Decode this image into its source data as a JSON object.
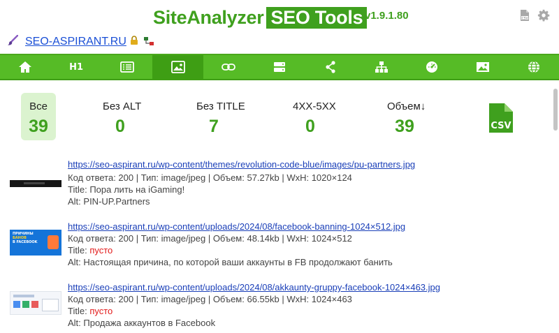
{
  "app": {
    "title_part1": "SiteAnalyzer",
    "title_part2": "SEO Tools",
    "version": "v1.9.1.80"
  },
  "site": {
    "domain": "SEO-ASPIRANT.RU"
  },
  "nav": {
    "tabs": [
      {
        "name": "home",
        "icon": "home-icon"
      },
      {
        "name": "h1",
        "label": "H1"
      },
      {
        "name": "list",
        "icon": "list-icon"
      },
      {
        "name": "images",
        "icon": "image-icon",
        "active": true
      },
      {
        "name": "links",
        "icon": "link-icon"
      },
      {
        "name": "server",
        "icon": "server-icon"
      },
      {
        "name": "share",
        "icon": "share-icon"
      },
      {
        "name": "sitemap",
        "icon": "sitemap-icon"
      },
      {
        "name": "speed",
        "icon": "gauge-icon"
      },
      {
        "name": "pictures",
        "icon": "picture-icon"
      },
      {
        "name": "globe",
        "icon": "globe-icon"
      }
    ]
  },
  "stats": [
    {
      "label": "Все",
      "value": "39"
    },
    {
      "label": "Без ALT",
      "value": "0"
    },
    {
      "label": "Без TITLE",
      "value": "7"
    },
    {
      "label": "4XX-5XX",
      "value": "0"
    },
    {
      "label": "Объем↓",
      "value": "39"
    }
  ],
  "csv_label": "CSV",
  "labels": {
    "code": "Код ответа:",
    "type": "Тип:",
    "size": "Объем:",
    "wh": "WxH:",
    "title": "Title:",
    "alt": "Alt:"
  },
  "images": [
    {
      "url": "https://seo-aspirant.ru/wp-content/themes/revolution-code-blue/images/pu-partners.jpg",
      "meta": "Код ответа: 200 | Тип: image/jpeg | Объем: 57.27kb | WxH: 1020×124",
      "title_label": "Title:",
      "title": "Пора лить на iGaming!",
      "title_empty": false,
      "alt": "Alt: PIN-UP.Partners"
    },
    {
      "url": "https://seo-aspirant.ru/wp-content/uploads/2024/08/facebook-banning-1024×512.jpg",
      "meta": "Код ответа: 200 | Тип: image/jpeg | Объем: 48.14kb | WxH: 1024×512",
      "title_label": "Title:",
      "title": "пусто",
      "title_empty": true,
      "alt": "Alt: Настоящая причина, по которой ваши аккаунты в FB продолжают банить",
      "thumb_text": [
        "ПРИЧИНЫ",
        "БАНОВ",
        "В FACEBOOK"
      ]
    },
    {
      "url": "https://seo-aspirant.ru/wp-content/uploads/2024/08/akkaunty-gruppy-facebook-1024×463.jpg",
      "meta": "Код ответа: 200 | Тип: image/jpeg | Объем: 66.55kb | WxH: 1024×463",
      "title_label": "Title:",
      "title": "пусто",
      "title_empty": true,
      "alt": "Alt: Продажа аккаунтов в Facebook"
    }
  ],
  "colors": {
    "accent": "#3fa01e",
    "nav_bg": "#56bb26",
    "nav_active": "#3e9e14",
    "link": "#1a3fb8",
    "empty": "#e21a1a"
  }
}
